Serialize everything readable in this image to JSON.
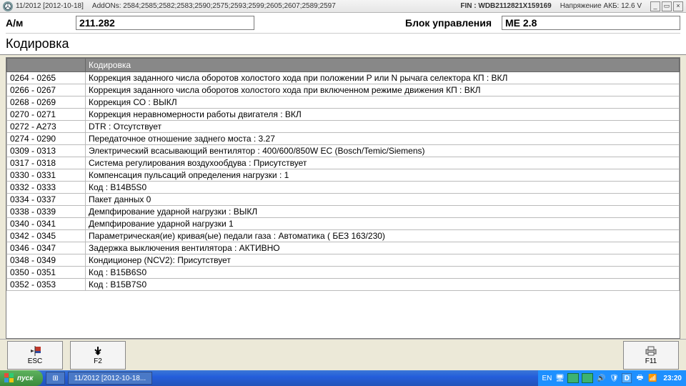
{
  "titlebar": {
    "version": "11/2012 [2012-10-18]",
    "addons": "AddONs: 2584;2585;2582;2583;2590;2575;2593;2599;2605;2607;2589;2597",
    "fin": "FIN : WDB2112821X159169",
    "voltage": "Напряжение АКБ: 12.6 V"
  },
  "header": {
    "vehicle_label": "А/м",
    "vehicle_value": "211.282",
    "cu_label": "Блок управления",
    "cu_value": "ME 2.8",
    "section": "Кодировка"
  },
  "table": {
    "cols": [
      "",
      "Кодировка"
    ],
    "rows": [
      {
        "c": "0264 - 0265",
        "d": "Коррекция заданного числа оборотов холостого хода при положении P или N рычага селектора КП : ВКЛ"
      },
      {
        "c": "0266 - 0267",
        "d": "Коррекция заданного числа оборотов холостого хода при включенном режиме движения КП : ВКЛ"
      },
      {
        "c": "0268 - 0269",
        "d": "Коррекция СО : ВЫКЛ"
      },
      {
        "c": "0270 - 0271",
        "d": "Коррекция неравномерности работы двигателя : ВКЛ"
      },
      {
        "c": "0272 - A273",
        "d": "DTR : Отсутствует"
      },
      {
        "c": "0274 - 0290",
        "d": "Передаточное отношение заднего моста : 3.27"
      },
      {
        "c": "0309 - 0313",
        "d": "Электрический всасывающий вентилятор : 400/600/850W EC (Bosch/Temic/Siemens)"
      },
      {
        "c": "0317 - 0318",
        "d": "Система регулирования воздухообдува : Присутствует"
      },
      {
        "c": "0330 - 0331",
        "d": "Компенсация пульсаций определения нагрузки : 1"
      },
      {
        "c": "0332 - 0333",
        "d": "Код : B14B5S0"
      },
      {
        "c": "0334 - 0337",
        "d": "Пакет данных 0"
      },
      {
        "c": "0338 - 0339",
        "d": "Демпфирование ударной нагрузки : ВЫКЛ"
      },
      {
        "c": "0340 - 0341",
        "d": "Демпфирование ударной нагрузки 1"
      },
      {
        "c": "0342 - 0345",
        "d": "Параметрическая(ие) кривая(ые) педали газа : Автоматика ( БЕЗ 163/230)"
      },
      {
        "c": "0346 - 0347",
        "d": "Задержка выключения вентилятора : АКТИВНО"
      },
      {
        "c": "0348 - 0349",
        "d": "Кондиционер (NCV2): Присутствует"
      },
      {
        "c": "0350 - 0351",
        "d": "Код : B15B6S0"
      },
      {
        "c": "0352 - 0353",
        "d": "Код : B15B7S0"
      }
    ]
  },
  "footer": {
    "esc": "ESC",
    "f2": "F2",
    "f11": "F11"
  },
  "taskbar": {
    "start": "пуск",
    "app": "11/2012 [2012-10-18...",
    "lang": "EN",
    "sym_d": "D",
    "clock": "23:20"
  }
}
